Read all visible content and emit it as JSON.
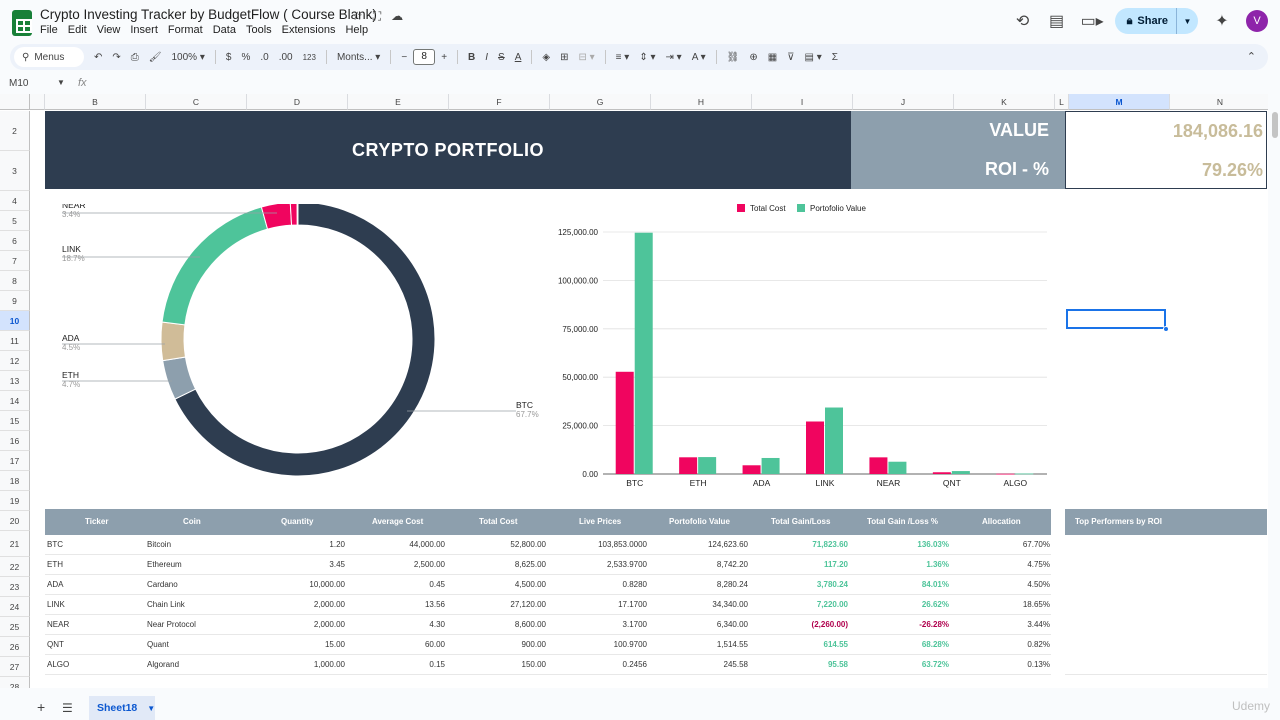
{
  "window": {
    "title": "Crypto Investing Tracker by BudgetFlow ( Course Blank)",
    "menu": [
      "File",
      "Edit",
      "View",
      "Insert",
      "Format",
      "Data",
      "Tools",
      "Extensions",
      "Help"
    ],
    "share_label": "Share",
    "avatar_letter": "V"
  },
  "toolbar": {
    "menus_label": "Menus",
    "zoom": "100%",
    "currency": "$",
    "percent": "%",
    "dec_dec": ".0",
    "inc_dec": ".00",
    "number_format": "123",
    "font": "Monts...",
    "font_size": "8",
    "minus": "−",
    "plus": "+"
  },
  "formula_bar": {
    "name_box": "M10",
    "fx": "fx"
  },
  "columns": [
    "B",
    "C",
    "D",
    "E",
    "F",
    "G",
    "H",
    "I",
    "J",
    "K",
    "L",
    "M",
    "N"
  ],
  "rows": [
    "2",
    "3",
    "4",
    "5",
    "6",
    "7",
    "8",
    "9",
    "10",
    "11",
    "12",
    "13",
    "14",
    "15",
    "16",
    "17",
    "18",
    "19",
    "20",
    "21",
    "22",
    "23",
    "24",
    "25",
    "26",
    "27",
    "28"
  ],
  "banner": {
    "title": "CRYPTO PORTFOLIO",
    "value_label": "VALUE",
    "value": "184,086.16",
    "roi_label": "ROI - %",
    "roi": "79.26%"
  },
  "chart_data": [
    {
      "type": "pie",
      "categories": [
        "BTC",
        "ETH",
        "ADA",
        "LINK",
        "NEAR",
        "QNT",
        "ALGO"
      ],
      "values": [
        67.7,
        4.7,
        4.5,
        18.7,
        3.4,
        0.8,
        0.1
      ],
      "labels": [
        {
          "name": "NEAR",
          "pct": "3.4%"
        },
        {
          "name": "LINK",
          "pct": "18.7%"
        },
        {
          "name": "ADA",
          "pct": "4.5%"
        },
        {
          "name": "ETH",
          "pct": "4.7%"
        },
        {
          "name": "BTC",
          "pct": "67.7%"
        }
      ],
      "colors": [
        "#2e3d50",
        "#8d9fad",
        "#d0bc98",
        "#4ec49a",
        "#f0055f",
        "#f0055f",
        "#a7d8f0"
      ]
    },
    {
      "type": "bar",
      "categories": [
        "BTC",
        "ETH",
        "ADA",
        "LINK",
        "NEAR",
        "QNT",
        "ALGO"
      ],
      "series": [
        {
          "name": "Total Cost",
          "color": "#f0055f",
          "values": [
            52800,
            8625,
            4500,
            27120,
            8600,
            900,
            150
          ]
        },
        {
          "name": "Portofolio Value",
          "color": "#4ec49a",
          "values": [
            124623.6,
            8742.2,
            8280.24,
            34340,
            6340,
            1514.55,
            245.58
          ]
        }
      ],
      "yticks": [
        "0.00",
        "25,000.00",
        "50,000.00",
        "75,000.00",
        "100,000.00",
        "125,000.00"
      ],
      "ylim": [
        0,
        125000
      ],
      "legend": "top"
    }
  ],
  "table": {
    "headers": [
      "Ticker",
      "Coin",
      "Quantity",
      "Average Cost",
      "Total Cost",
      "Live Prices",
      "Portofolio Value",
      "Total Gain/Loss",
      "Total Gain /Loss %",
      "Allocation"
    ],
    "top_performers_header": "Top Performers by ROI",
    "rows": [
      {
        "ticker": "BTC",
        "coin": "Bitcoin",
        "qty": "1.20",
        "avg": "44,000.00",
        "cost": "52,800.00",
        "price": "103,853.0000",
        "value": "124,623.60",
        "gain": "71,823.60",
        "gain_pct": "136.03%",
        "alloc": "67.70%",
        "neg": false
      },
      {
        "ticker": "ETH",
        "coin": "Ethereum",
        "qty": "3.45",
        "avg": "2,500.00",
        "cost": "8,625.00",
        "price": "2,533.9700",
        "value": "8,742.20",
        "gain": "117.20",
        "gain_pct": "1.36%",
        "alloc": "4.75%",
        "neg": false
      },
      {
        "ticker": "ADA",
        "coin": "Cardano",
        "qty": "10,000.00",
        "avg": "0.45",
        "cost": "4,500.00",
        "price": "0.8280",
        "value": "8,280.24",
        "gain": "3,780.24",
        "gain_pct": "84.01%",
        "alloc": "4.50%",
        "neg": false
      },
      {
        "ticker": "LINK",
        "coin": "Chain Link",
        "qty": "2,000.00",
        "avg": "13.56",
        "cost": "27,120.00",
        "price": "17.1700",
        "value": "34,340.00",
        "gain": "7,220.00",
        "gain_pct": "26.62%",
        "alloc": "18.65%",
        "neg": false
      },
      {
        "ticker": "NEAR",
        "coin": "Near Protocol",
        "qty": "2,000.00",
        "avg": "4.30",
        "cost": "8,600.00",
        "price": "3.1700",
        "value": "6,340.00",
        "gain": "(2,260.00)",
        "gain_pct": "-26.28%",
        "alloc": "3.44%",
        "neg": true
      },
      {
        "ticker": "QNT",
        "coin": "Quant",
        "qty": "15.00",
        "avg": "60.00",
        "cost": "900.00",
        "price": "100.9700",
        "value": "1,514.55",
        "gain": "614.55",
        "gain_pct": "68.28%",
        "alloc": "0.82%",
        "neg": false
      },
      {
        "ticker": "ALGO",
        "coin": "Algorand",
        "qty": "1,000.00",
        "avg": "0.15",
        "cost": "150.00",
        "price": "0.2456",
        "value": "245.58",
        "gain": "95.58",
        "gain_pct": "63.72%",
        "alloc": "0.13%",
        "neg": false
      }
    ]
  },
  "sheet_tab": "Sheet18",
  "corner_watermark": "Udemy"
}
